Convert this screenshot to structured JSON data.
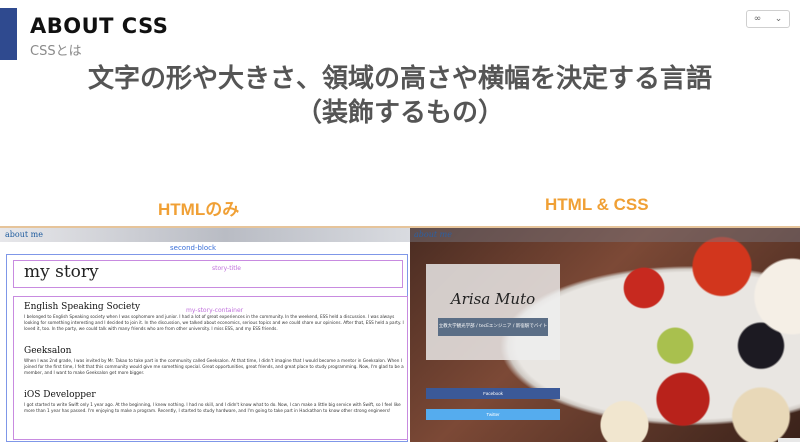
{
  "slide": {
    "title": "ABOUT CSS",
    "subtitle": "CSSとは",
    "headline_line1": "文字の形や大きさ、領域の高さや横幅を決定する言語",
    "headline_line2": "（装飾するもの）",
    "left_label": "HTMLのみ",
    "right_label": "HTML & CSS",
    "control_left": "∞",
    "control_right": "⌄"
  },
  "left_panel": {
    "header": "about me",
    "second_block_label": "second-block",
    "story_title_label": "story-title",
    "story_title": "my story",
    "container_label": "my-story-container",
    "sections": [
      {
        "heading": "English Speaking Society",
        "text": "I belonged to English Speaking society when I was sophomore and junior. I had a lot of great experiences in the community. In the weekend, ESS held a discussion. I was always looking for something interesting and I decided to join it. In the discussion, we talked about economics, serious topics and we could share our opinions. After that, ESS held a party. I loved it, too. In the party, we could talk with many friends who are from other university. I miss ESS, and my ESS friends."
      },
      {
        "heading": "Geeksalon",
        "text": "When I was 2nd grade, I was invited by Mr. Takao to take part in the community called Geeksalon. At that time, I didn't imagine that I would become a mentor in Geeksalon. When I joined for the first time, I felt that this community would give me something special. Great opportunities, great friends, and great place to study programming. Now, I'm glad to be a member, and I want to make Geeksalon get more bigger."
      },
      {
        "heading": "iOS Developper",
        "text": "I got started to write Swift only 1 year ago. At the beginning, I knew nothing. I had no skill, and I didn't know what to do. Now, I can make a little big service with Swift, so I feel like more than 1 year has passed. I'm enjoying to make a program. Recently, I started to study hardware, and I'm going to take part in Hackathon to know other strong engineers!"
      }
    ]
  },
  "right_panel": {
    "header": "about me",
    "name": "Arisa Muto",
    "tagline": "立教大学観光学部 / tecEエンジニア / 新宿駅でバイト",
    "facebook_label": "Facebook",
    "twitter_label": "Twitter"
  }
}
